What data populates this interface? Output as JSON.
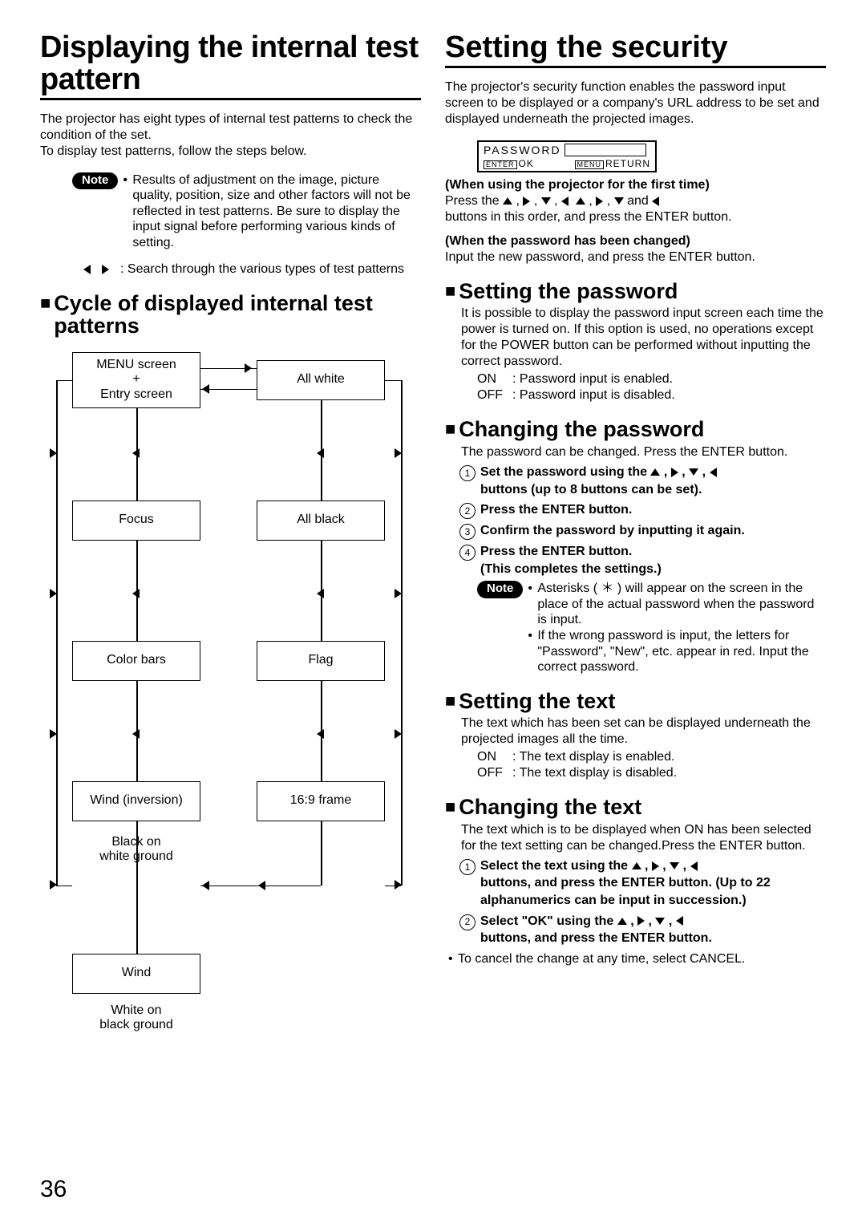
{
  "page_number": "36",
  "left": {
    "heading": "Displaying the internal test pattern",
    "intro1": "The projector has eight types of internal test patterns to check the condition of the set.",
    "intro2": "To display test patterns, follow the steps below.",
    "note_label": "Note",
    "note_text": "Results of adjustment on the image, picture quality, position, size and other factors will not be reflected in test patterns. Be sure to display the input signal before performing various kinds of setting.",
    "arrow_text": ": Search through the various types of test patterns",
    "subheading": "Cycle of displayed internal test patterns",
    "boxes": {
      "menu": "MENU screen\n+\nEntry screen",
      "allwhite": "All white",
      "focus": "Focus",
      "allblack": "All black",
      "colorbars": "Color bars",
      "flag": "Flag",
      "windinv": "Wind (inversion)",
      "frame169": "16:9 frame",
      "wind": "Wind"
    },
    "label_bw": "Black on\nwhite ground",
    "label_wb": "White on\nblack ground"
  },
  "right": {
    "heading": "Setting the security",
    "intro": "The projector's security function enables the password input screen to be displayed or a company's URL address to be set and displayed underneath the projected images.",
    "pwbox": {
      "password_label": "PASSWORD",
      "enter": "ENTER",
      "ok": "OK",
      "menu": "MENU",
      "return": "RETURN"
    },
    "first_time_hdr": "(When using the projector for the first time)",
    "first_time_body1": "Press the",
    "first_time_body2": "and",
    "first_time_body3": "buttons in this order, and press the ENTER button.",
    "changed_hdr": "(When the password has been changed)",
    "changed_body": "Input the new password, and press the ENTER button.",
    "s_password_h": "Setting the password",
    "s_password_b": "It is possible to display the password input screen each time the power is turned on. If this option is used, no operations except for the POWER button can be performed without inputting the correct password.",
    "s_password_on": ": Password input is enabled.",
    "s_password_off": ": Password input is disabled.",
    "c_password_h": "Changing the password",
    "c_password_b": "The password can be changed. Press the ENTER button.",
    "c_password_step1a": "Set the password using the",
    "c_password_step1b": "buttons (up to 8 buttons can be set).",
    "c_password_step2": "Press the ENTER button.",
    "c_password_step3": "Confirm the password by inputting it again.",
    "c_password_step4a": "Press the ENTER button.",
    "c_password_step4b": "(This completes the settings.)",
    "c_password_note_label": "Note",
    "c_password_note1": "Asterisks ( ＊ ) will appear on the screen in the place of the actual password when the password is input.",
    "c_password_note2": "If the wrong password is input, the letters for \"Password\", \"New\", etc. appear in red. Input the correct password.",
    "s_text_h": "Setting the text",
    "s_text_b": "The text which has been set can be displayed underneath the projected images all the time.",
    "s_text_on": ": The text display is enabled.",
    "s_text_off": ": The text display is disabled.",
    "c_text_h": "Changing the text",
    "c_text_b": "The text which is to be displayed when ON has been selected for the text setting can be changed.Press the ENTER button.",
    "c_text_step1a": "Select the text using the",
    "c_text_step1b": "buttons, and press the ENTER button. (Up to 22 alphanumerics can be input in succession.)",
    "c_text_step2a": "Select \"OK\" using the",
    "c_text_step2b": "buttons, and press the ENTER button.",
    "c_text_cancel": "To cancel the change at any time, select CANCEL.",
    "on_label": "ON",
    "off_label": "OFF"
  }
}
